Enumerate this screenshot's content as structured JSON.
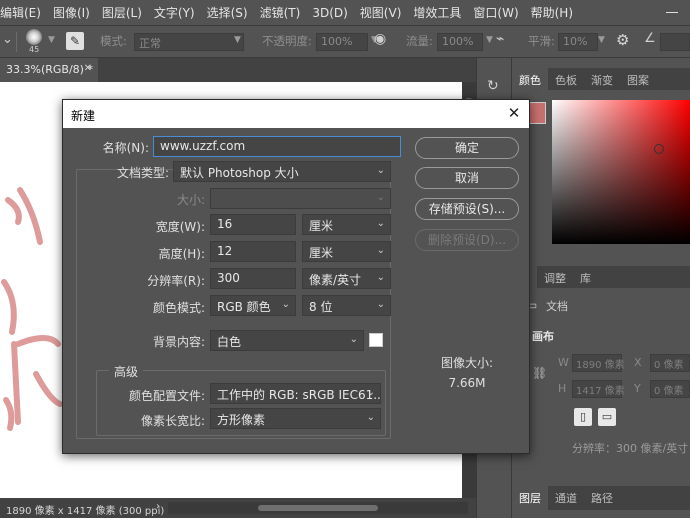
{
  "menubar": {
    "items": [
      "编辑(E)",
      "图像(I)",
      "图层(L)",
      "文字(Y)",
      "选择(S)",
      "滤镜(T)",
      "3D(D)",
      "视图(V)",
      "增效工具",
      "窗口(W)",
      "帮助(H)"
    ]
  },
  "options": {
    "brush_size": "45",
    "mode_label": "模式:",
    "mode_value": "正常",
    "opacity_label": "不透明度:",
    "opacity_value": "100%",
    "flow_label": "流量:",
    "flow_value": "100%",
    "smooth_label": "平滑:",
    "smooth_value": "10%"
  },
  "document": {
    "tab_title": "33.3%(RGB/8) *",
    "status": "1890 像素 x 1417 像素 (300 ppi)"
  },
  "color_panel": {
    "tabs": [
      "颜色",
      "色板",
      "渐变",
      "图案"
    ],
    "foreground_color": "#c87070"
  },
  "properties_panel": {
    "tabs": [
      "性",
      "调整",
      "库"
    ],
    "doc_label": "文档",
    "canvas_label": "画布",
    "w_label": "W",
    "w_value": "1890 像素",
    "h_label": "H",
    "h_value": "1417 像素",
    "x_label": "X",
    "x_value": "0 像素",
    "y_label": "Y",
    "y_value": "0 像素",
    "resolution": "分辨率：300 像素/英寸"
  },
  "layers_panel": {
    "tabs": [
      "图层",
      "通道",
      "路径"
    ]
  },
  "dialog": {
    "title": "新建",
    "name_label": "名称(N):",
    "name_value": "www.uzzf.com",
    "preset_label": "文档类型:",
    "preset_value": "默认 Photoshop 大小",
    "size_label": "大小:",
    "size_value": "",
    "width_label": "宽度(W):",
    "width_value": "16",
    "width_unit": "厘米",
    "height_label": "高度(H):",
    "height_value": "12",
    "height_unit": "厘米",
    "resolution_label": "分辨率(R):",
    "resolution_value": "300",
    "resolution_unit": "像素/英寸",
    "color_mode_label": "颜色模式:",
    "color_mode_value": "RGB 颜色",
    "bit_depth_value": "8 位",
    "background_label": "背景内容:",
    "background_value": "白色",
    "advanced_title": "高级",
    "color_profile_label": "颜色配置文件:",
    "color_profile_value": "工作中的 RGB: sRGB IEC61...",
    "pixel_aspect_label": "像素长宽比:",
    "pixel_aspect_value": "方形像素",
    "buttons": {
      "ok": "确定",
      "cancel": "取消",
      "save_preset": "存储预设(S)...",
      "delete_preset": "删除预设(D)..."
    },
    "image_size_label": "图像大小:",
    "image_size_value": "7.66M"
  }
}
